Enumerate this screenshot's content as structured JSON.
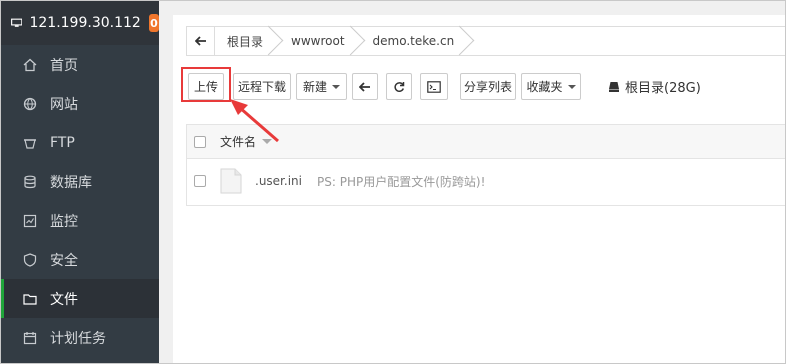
{
  "server": {
    "ip": "121.199.30.112",
    "badge_count": "0"
  },
  "sidebar": {
    "items": [
      {
        "label": "首页",
        "icon": "home-icon"
      },
      {
        "label": "网站",
        "icon": "globe-icon"
      },
      {
        "label": "FTP",
        "icon": "ftp-icon"
      },
      {
        "label": "数据库",
        "icon": "database-icon"
      },
      {
        "label": "监控",
        "icon": "monitor-chart-icon"
      },
      {
        "label": "安全",
        "icon": "shield-icon"
      },
      {
        "label": "文件",
        "icon": "folder-icon",
        "active": true
      },
      {
        "label": "计划任务",
        "icon": "calendar-icon"
      }
    ]
  },
  "breadcrumb": {
    "segments": [
      "根目录",
      "wwwroot",
      "demo.teke.cn"
    ]
  },
  "toolbar": {
    "upload": "上传",
    "remote_download": "远程下载",
    "new": "新建",
    "share_list": "分享列表",
    "favorites": "收藏夹",
    "disk": "根目录(28G)"
  },
  "file_table": {
    "header_filename": "文件名",
    "rows": [
      {
        "name": ".user.ini",
        "description": "PS: PHP用户配置文件(防跨站)!"
      }
    ]
  },
  "colors": {
    "sidebar_bg": "#333c44",
    "accent_green": "#20a53a",
    "badge_orange": "#f0762c",
    "highlight_red": "#e83a3a"
  }
}
